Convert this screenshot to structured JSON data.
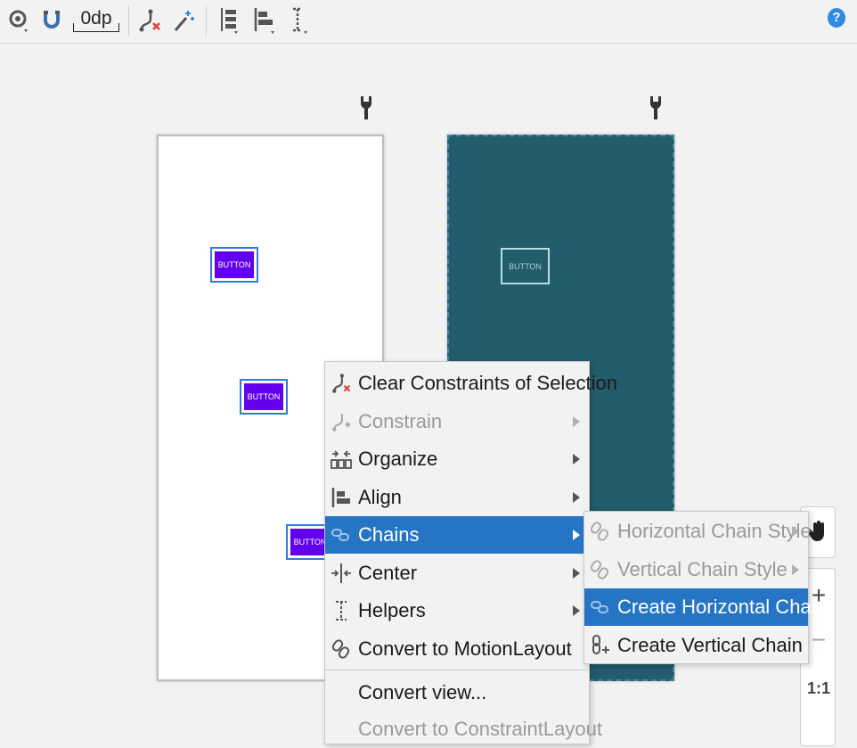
{
  "toolbar": {
    "view_options_icon": "eye-icon",
    "autoconnect_icon": "magnet-icon",
    "default_margin": "0dp",
    "clear_constraints_icon": "clear-constraints-icon",
    "infer_constraints_icon": "magic-wand-icon",
    "pack_icon": "pack-icon",
    "align_icon": "align-icon",
    "guidelines_icon": "guidelines-icon",
    "help_label": "?"
  },
  "canvas": {
    "buttons": [
      "BUTTON",
      "BUTTON",
      "BUTTON"
    ],
    "blueprint_button": "BUTTON",
    "accent_color": "#6200ee",
    "blueprint_color": "#235c6c"
  },
  "side_panel": {
    "pan": "pan-hand-icon",
    "zoom_in": "+",
    "zoom_out": "−",
    "actual_size": "1:1"
  },
  "context_menu": {
    "items": [
      {
        "label": "Clear Constraints of Selection",
        "icon": "clear-constraints-icon",
        "enabled": true,
        "submenu": false
      },
      {
        "label": "Constrain",
        "icon": "constrain-icon",
        "enabled": false,
        "submenu": true
      },
      {
        "label": "Organize",
        "icon": "organize-icon",
        "enabled": true,
        "submenu": true
      },
      {
        "label": "Align",
        "icon": "align-icon",
        "enabled": true,
        "submenu": true
      },
      {
        "label": "Chains",
        "icon": "chain-icon",
        "enabled": true,
        "submenu": true,
        "selected": true
      },
      {
        "label": "Center",
        "icon": "center-icon",
        "enabled": true,
        "submenu": true
      },
      {
        "label": "Helpers",
        "icon": "helpers-icon",
        "enabled": true,
        "submenu": true
      },
      {
        "label": "Convert to MotionLayout",
        "icon": "motion-layout-icon",
        "enabled": true,
        "submenu": false
      },
      {
        "label": "Convert view...",
        "enabled": true,
        "submenu": false
      },
      {
        "label": "Convert to ConstraintLayout",
        "enabled": false,
        "submenu": false
      }
    ]
  },
  "chains_submenu": {
    "items": [
      {
        "label": "Horizontal Chain Style",
        "enabled": false,
        "submenu": true
      },
      {
        "label": "Vertical Chain Style",
        "enabled": false,
        "submenu": true
      },
      {
        "label": "Create Horizontal Chain",
        "enabled": true,
        "selected": true
      },
      {
        "label": "Create Vertical Chain",
        "enabled": true
      }
    ]
  }
}
